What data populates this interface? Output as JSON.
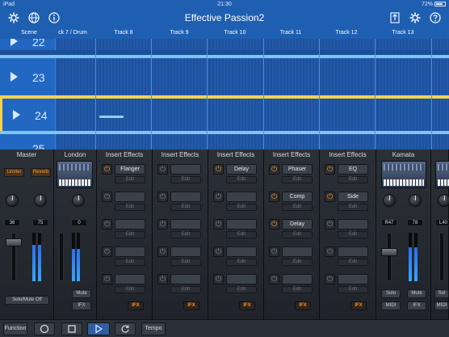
{
  "status_bar": {
    "device": "iPad",
    "time": "21:30",
    "battery": "72%"
  },
  "title_bar": {
    "title": "Effective Passion2",
    "icons": [
      "gear-icon",
      "globe-icon",
      "info-icon",
      "upload-icon",
      "settings-gear-icon",
      "help-icon"
    ]
  },
  "track_header": {
    "scene_label": "Scene",
    "tracks": [
      "ck 7 / Drum",
      "Track 8",
      "Track 9",
      "Track 10",
      "Track 11",
      "Track 12",
      "Track 13"
    ]
  },
  "scenes": [
    {
      "number": "22"
    },
    {
      "number": "23"
    },
    {
      "number": "24"
    },
    {
      "number": "25"
    }
  ],
  "colors": {
    "accent_blue": "#1f5fb1",
    "selection_yellow": "#f5d34a",
    "effect_orange": "#ff8f22"
  },
  "mixer": {
    "master": {
      "title": "Master",
      "btn_limiter": "Limiter",
      "btn_reverb": "Reverb",
      "knob1_value": "36",
      "knob2_value": "75",
      "solo_mute_off": "Solo/Mute Off"
    },
    "london": {
      "title": "London",
      "knob_value": "0",
      "mute": "Mute",
      "ifx": "IFX"
    },
    "insert_effects": [
      {
        "title": "Insert Effects",
        "slots": [
          {
            "name": "Flanger",
            "on": true
          },
          {
            "name": "",
            "on": false
          },
          {
            "name": "",
            "on": false
          },
          {
            "name": "",
            "on": false
          },
          {
            "name": "",
            "on": false
          }
        ],
        "edit": "Edit",
        "ifx": "IFX"
      },
      {
        "title": "Insert Effects",
        "slots": [
          {
            "name": "",
            "on": false
          },
          {
            "name": "",
            "on": false
          },
          {
            "name": "",
            "on": false
          },
          {
            "name": "",
            "on": false
          },
          {
            "name": "",
            "on": false
          }
        ],
        "edit": "Edit",
        "ifx": "IFX"
      },
      {
        "title": "Insert Effects",
        "slots": [
          {
            "name": "Delay",
            "on": true
          },
          {
            "name": "",
            "on": false
          },
          {
            "name": "",
            "on": false
          },
          {
            "name": "",
            "on": false
          },
          {
            "name": "",
            "on": false
          }
        ],
        "edit": "Edit",
        "ifx": "IFX"
      },
      {
        "title": "Insert Effects",
        "slots": [
          {
            "name": "Phaser",
            "on": true
          },
          {
            "name": "Comp",
            "on": true
          },
          {
            "name": "Delay",
            "on": true
          },
          {
            "name": "",
            "on": false
          },
          {
            "name": "",
            "on": false
          }
        ],
        "edit": "Edit",
        "ifx": "IFX"
      },
      {
        "title": "Insert Effects",
        "slots": [
          {
            "name": "EQ",
            "on": true
          },
          {
            "name": "Side",
            "on": true
          },
          {
            "name": "",
            "on": false
          },
          {
            "name": "",
            "on": false
          },
          {
            "name": "",
            "on": false
          }
        ],
        "edit": "Edit",
        "ifx": "IFX"
      }
    ],
    "kamata": {
      "title": "Kamata",
      "knob1_value": "R47",
      "knob2_value": "78",
      "solo": "Solo",
      "mute": "Mute",
      "midi": "MIDI",
      "ifx": "IFX"
    },
    "next": {
      "knob_value": "L40",
      "solo": "Sol",
      "midi": "MIDI"
    }
  },
  "transport": {
    "function": "Function",
    "tempo": "Tempo"
  }
}
